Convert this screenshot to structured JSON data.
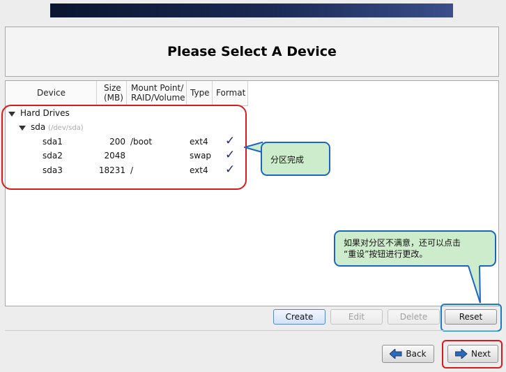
{
  "page": {
    "title": "Please Select A Device"
  },
  "table": {
    "columns": {
      "device": "Device",
      "size_line1": "Size",
      "size_line2": "(MB)",
      "mount_line1": "Mount Point/",
      "mount_line2": "RAID/Volume",
      "type": "Type",
      "format": "Format"
    },
    "group_label": "Hard Drives",
    "drive": {
      "name": "sda",
      "path": "(/dev/sda)"
    },
    "rows": [
      {
        "device": "sda1",
        "size": "200",
        "mount": "/boot",
        "type": "ext4",
        "format": "✓"
      },
      {
        "device": "sda2",
        "size": "2048",
        "mount": "",
        "type": "swap",
        "format": "✓"
      },
      {
        "device": "sda3",
        "size": "18231",
        "mount": "/",
        "type": "ext4",
        "format": "✓"
      }
    ]
  },
  "toolbar": {
    "create": "Create",
    "edit": "Edit",
    "delete": "Delete",
    "reset": "Reset"
  },
  "nav": {
    "back": "Back",
    "next": "Next"
  },
  "annotations": {
    "partition_done": "分区完成",
    "reset_hint_line1": "如果对分区不满意，还可以点击",
    "reset_hint_line2": "“重设”按钮进行更改。"
  },
  "colors": {
    "highlight_red": "#d81a1f",
    "highlight_blue": "#1a7cc5",
    "callout_fill": "#cdeccb"
  }
}
